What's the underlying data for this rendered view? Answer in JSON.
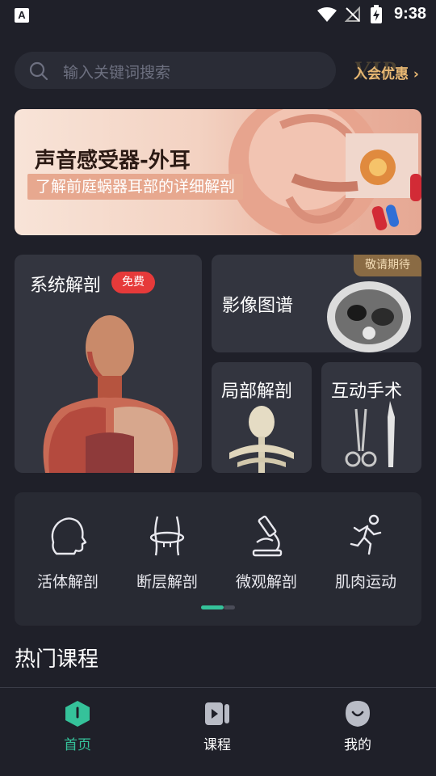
{
  "status_bar": {
    "app_badge": "A",
    "time": "9:38"
  },
  "search": {
    "placeholder": "输入关键词搜索"
  },
  "vip": {
    "label": "入会优惠 ›",
    "watermark": "VIP"
  },
  "banner": {
    "title": "声音感受器-外耳",
    "subtitle": "了解前庭蜗器耳部的详细解剖"
  },
  "cards": {
    "system": {
      "title": "系统解剖",
      "badge": "免费"
    },
    "imaging": {
      "title": "影像图谱",
      "badge": "敬请期待"
    },
    "local": {
      "title": "局部解剖"
    },
    "surgery": {
      "title": "互动手术"
    }
  },
  "shortcuts": [
    {
      "label": "活体解剖",
      "icon": "head-profile-icon"
    },
    {
      "label": "断层解剖",
      "icon": "torso-section-icon"
    },
    {
      "label": "微观解剖",
      "icon": "microscope-icon"
    },
    {
      "label": "肌肉运动",
      "icon": "running-person-icon"
    }
  ],
  "shortcut_page": {
    "current": 1,
    "total": 2
  },
  "sections": {
    "hot_courses": "热门课程"
  },
  "tabs": [
    {
      "label": "首页",
      "icon": "home-icon",
      "active": true
    },
    {
      "label": "课程",
      "icon": "course-video-icon",
      "active": false
    },
    {
      "label": "我的",
      "icon": "profile-face-icon",
      "active": false
    }
  ],
  "colors": {
    "accent": "#35c29a",
    "vip": "#e8b873",
    "free_badge": "#e63a3a",
    "background": "#1f2029"
  }
}
